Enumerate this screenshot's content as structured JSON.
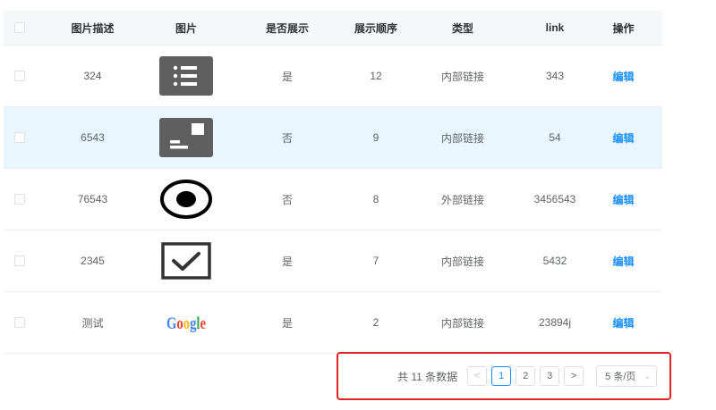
{
  "table": {
    "headers": [
      "图片描述",
      "图片",
      "是否展示",
      "展示顺序",
      "类型",
      "link",
      "操作"
    ],
    "rows": [
      {
        "desc": "324",
        "image": "list-icon",
        "show": "是",
        "order": "12",
        "type": "内部链接",
        "link": "343",
        "action": "编辑",
        "highlighted": false
      },
      {
        "desc": "6543",
        "image": "card-icon",
        "show": "否",
        "order": "9",
        "type": "内部链接",
        "link": "54",
        "action": "编辑",
        "highlighted": true
      },
      {
        "desc": "76543",
        "image": "record-icon",
        "show": "否",
        "order": "8",
        "type": "外部链接",
        "link": "3456543",
        "action": "编辑",
        "highlighted": false
      },
      {
        "desc": "2345",
        "image": "checkbox-icon",
        "show": "是",
        "order": "7",
        "type": "内部链接",
        "link": "5432",
        "action": "编辑",
        "highlighted": false
      },
      {
        "desc": "测试",
        "image": "google-logo",
        "show": "是",
        "order": "2",
        "type": "内部链接",
        "link": "23894j",
        "action": "编辑",
        "highlighted": false
      }
    ]
  },
  "pagination": {
    "total_text": "共 11 条数据",
    "prev": "<",
    "next": ">",
    "pages": [
      "1",
      "2",
      "3"
    ],
    "current_page": "1",
    "page_size": "5 条/页",
    "logo_text": "Google"
  },
  "colors": {
    "accent": "#1890ff",
    "highlight_row": "#e8f6fd",
    "annotation_border": "#e02424",
    "icon_gray": "#5f5f5f"
  }
}
